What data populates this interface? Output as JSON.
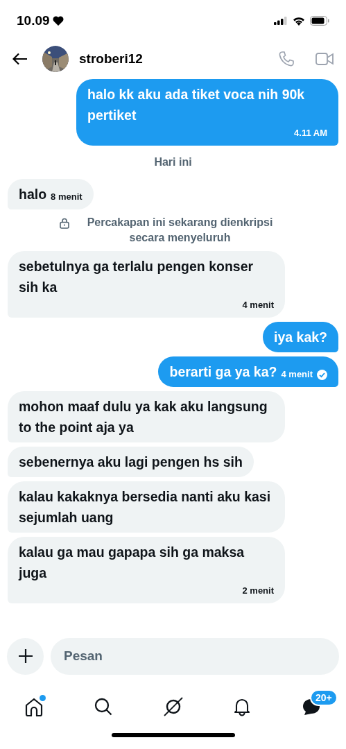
{
  "status_bar": {
    "time": "10.09"
  },
  "header": {
    "username": "stroberi12"
  },
  "messages": [
    {
      "kind": "sent",
      "text": "halo kk aku ada tiket voca nih 90k pertiket",
      "time": "4.11 AM",
      "read": false
    },
    {
      "kind": "divider",
      "text": "Hari ini"
    },
    {
      "kind": "received",
      "text": "halo",
      "time": "8 menit"
    },
    {
      "kind": "notice",
      "text": "Percakapan ini sekarang dienkripsi secara menyeluruh"
    },
    {
      "kind": "received",
      "text": "sebetulnya ga terlalu pengen konser sih ka",
      "time": "4 menit"
    },
    {
      "kind": "sent",
      "text": "iya kak?",
      "read": false
    },
    {
      "kind": "sent",
      "text": "berarti ga ya ka?",
      "time": "4 menit",
      "read": true
    },
    {
      "kind": "received",
      "text": "mohon maaf dulu ya kak aku langsung to the point aja ya"
    },
    {
      "kind": "received",
      "text": "sebenernya aku lagi pengen hs sih"
    },
    {
      "kind": "received",
      "text": "kalau kakaknya bersedia nanti aku kasi sejumlah uang"
    },
    {
      "kind": "received",
      "text": "kalau ga mau gapapa sih ga maksa juga",
      "time": "2 menit"
    }
  ],
  "composer": {
    "placeholder": "Pesan"
  },
  "nav": {
    "home_dot": true,
    "messages_badge": "20+"
  }
}
